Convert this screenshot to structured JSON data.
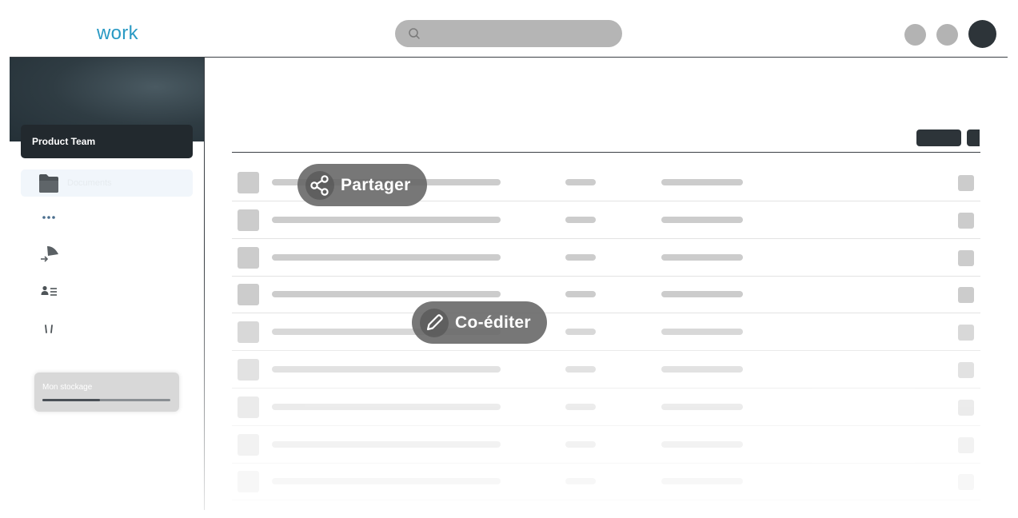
{
  "app": {
    "logo_text": "work"
  },
  "header": {
    "search": {
      "placeholder": ""
    }
  },
  "sidebar": {
    "team_name": "Product Team",
    "items": [
      {
        "icon": "folder-icon",
        "label": "Documents"
      },
      {
        "icon": "more-dots-icon",
        "label": ""
      },
      {
        "icon": "send-icon",
        "label": ""
      },
      {
        "icon": "contacts-icon",
        "label": ""
      },
      {
        "icon": "trash-icon",
        "label": ""
      }
    ],
    "storage": {
      "label": "Mon stockage",
      "used_fraction": 0.45
    }
  },
  "badges": {
    "share": {
      "label": "Partager",
      "icon": "share-icon"
    },
    "coedit": {
      "label": "Co-éditer",
      "icon": "pencil-icon"
    }
  },
  "colors": {
    "brand": "#2a9ac4",
    "dark": "#22292e",
    "placeholder": "#cccccc"
  }
}
